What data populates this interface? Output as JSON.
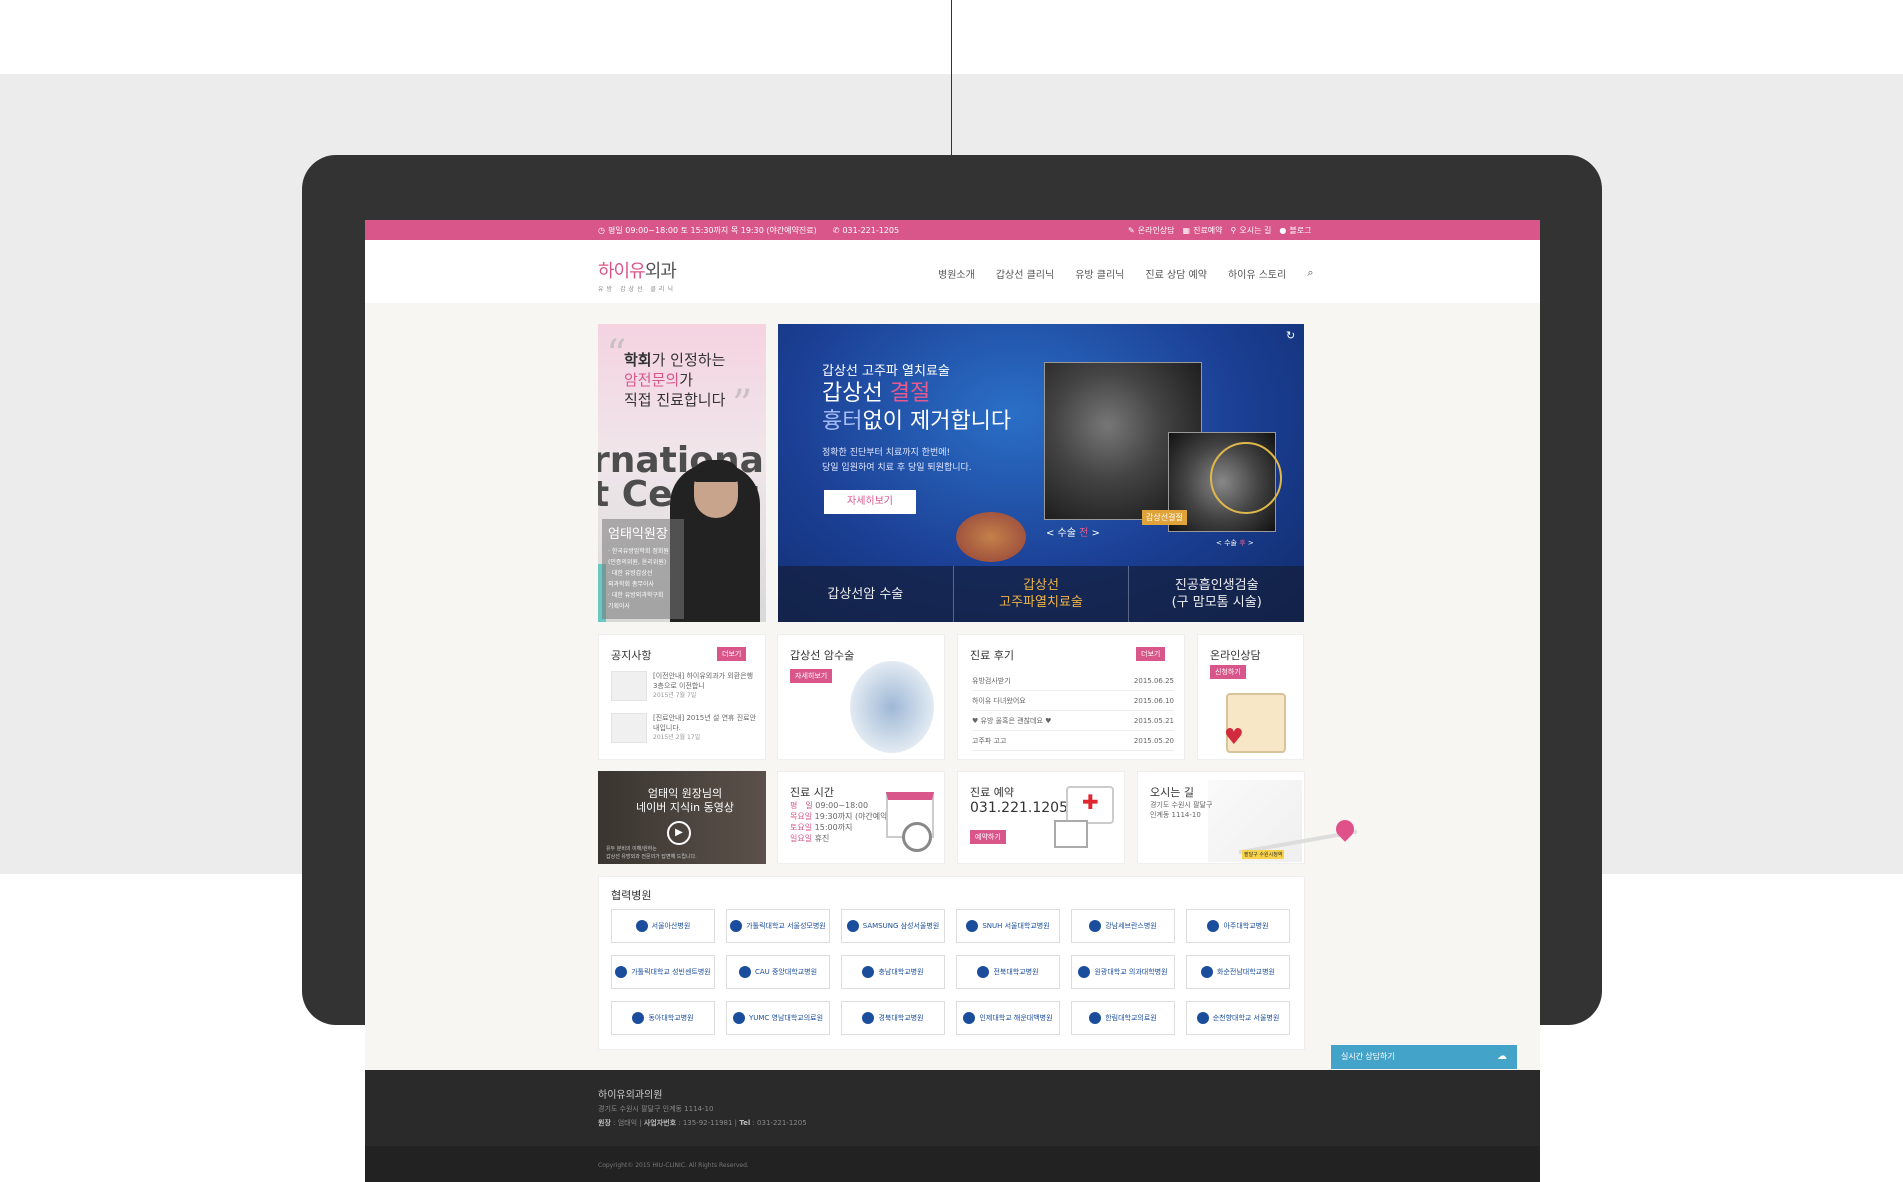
{
  "topbar": {
    "hours": "평일 09:00~18:00 토 15:30까지 목 19:30 (야간예약진료)",
    "phone": "031-221-1205",
    "links": [
      "온라인상담",
      "진료예약",
      "오시는 길",
      "블로그"
    ]
  },
  "header": {
    "logo_pink": "하이유",
    "logo_gray": "외과",
    "logo_sub": "유방 갑상선 클리닉",
    "nav": [
      "병원소개",
      "갑상선 클리닉",
      "유방 클리닉",
      "진료 상담 예약",
      "하이유 스토리"
    ]
  },
  "doctor": {
    "line1_b": "학회",
    "line1": "가 인정하는",
    "line2_pink": "암전문의",
    "line2": "가",
    "line3": "직접 진료합니다",
    "bg_text1": "rnational",
    "bg_text2": "t Center",
    "name": "엄태익원장",
    "career": [
      "· 한국유방암학회 정회원",
      "(인증의위원, 윤리위원)",
      "· 대한 유방갑상선",
      "외과학회 총무이사",
      "· 대한 유방외과학구회",
      "기획이사"
    ]
  },
  "hero": {
    "small": "갑상선 고주파 열치료술",
    "big1_a": "갑상선 ",
    "big1_b": "결절",
    "big2_a": "흉터",
    "big2_b": "없이 제거합니다",
    "desc1": "정확한 진단부터 치료까지 한번에!",
    "desc2": "당일 입원하여 치료 후 당일 퇴원합니다.",
    "button": "자세히보기",
    "tag": "갑상선결절",
    "cap1_a": "< 수술 ",
    "cap1_b": "전",
    "cap1_c": " >",
    "cap2_a": "< 수술 ",
    "cap2_b": "후",
    "cap2_c": " >",
    "tabs": [
      {
        "line1": "갑상선암 수술",
        "line2": ""
      },
      {
        "line1": "갑상선",
        "line2": "고주파열치료술"
      },
      {
        "line1": "진공흡인생검술",
        "line2": "(구 맘모톰 시술)"
      }
    ]
  },
  "notice": {
    "title": "공지사항",
    "more": "더보기",
    "items": [
      {
        "text": "[이전안내] 하이유외과가 외환은행 3층으로 이전합니",
        "date": "2015년 7월 7일"
      },
      {
        "text": "[진료안내] 2015년 설 연휴 진료안내입니다.",
        "date": "2015년 2월 17일"
      }
    ]
  },
  "surgery": {
    "title": "갑상선 암수술",
    "more": "자세히보기"
  },
  "review": {
    "title": "진료 후기",
    "more": "더보기",
    "rows": [
      {
        "t": "유방검사받기",
        "d": "2015.06.25"
      },
      {
        "t": "하이유 다녀왔어요",
        "d": "2015.06.10"
      },
      {
        "t": "♥ 유방 울혹은 괜찮데요 ♥",
        "d": "2015.05.21"
      },
      {
        "t": "고주파 고고",
        "d": "2015.05.20"
      }
    ]
  },
  "online": {
    "title": "온라인상담",
    "more": "신청하기"
  },
  "video": {
    "title1": "엄태익 원장님의",
    "title2": "네이버 지식in 동영상",
    "sub1": "유두 분비의 이해/원하는",
    "sub2": "갑상선 유방외과 전문의가 답변해 드립니다."
  },
  "hours": {
    "title": "진료 시간",
    "rows": [
      {
        "l": "평　일",
        "v": " 09:00~18:00"
      },
      {
        "l": "목요일",
        "v": " 19:30까지 (야간예약진료)"
      },
      {
        "l": "토요일",
        "v": " 15:00까지"
      },
      {
        "l": "일요일",
        "v": " 휴진"
      }
    ]
  },
  "reserve": {
    "title": "진료 예약",
    "phone": "031.221.1205",
    "button": "예약하기"
  },
  "directions": {
    "title": "오시는 길",
    "addr1": "경기도 수원시 팔달구",
    "addr2": "인계동 1114-10",
    "tag": "팔달구 수원시청역"
  },
  "partners": {
    "title": "협력병원",
    "items": [
      "서울아산병원",
      "가톨릭대학교 서울성모병원",
      "SAMSUNG 삼성서울병원",
      "SNUH 서울대학교병원",
      "강남세브란스병원",
      "아주대학교병원",
      "가톨릭대학교 성빈센트병원",
      "CAU 중앙대학교병원",
      "충남대학교병원",
      "전북대학교병원",
      "원광대학교 의과대학병원",
      "화순전남대학교병원",
      "동아대학교병원",
      "YUMC 영남대학교의료원",
      "경북대학교병원",
      "인제대학교 해운대백병원",
      "한림대학교의료원",
      "순천향대학교 서울병원"
    ]
  },
  "chat": {
    "label": "실시간 상담하기"
  },
  "footer": {
    "name": "하이유외과의원",
    "addr": "경기도 수원시 팔달구 인계동 1114-10",
    "rep_label": "원장",
    "rep": " : 엄태익 | ",
    "biz_label": "사업자번호",
    "biz": " : 135-92-11981 | ",
    "tel_label": "Tel",
    "tel": " : 031-221-1205",
    "copy": "Copyright© 2015 HIU-CLINIC. All Rights Reserved."
  },
  "colors": {
    "accent": "#d9568a",
    "dark": "#333333",
    "chat": "#44a3c8"
  }
}
